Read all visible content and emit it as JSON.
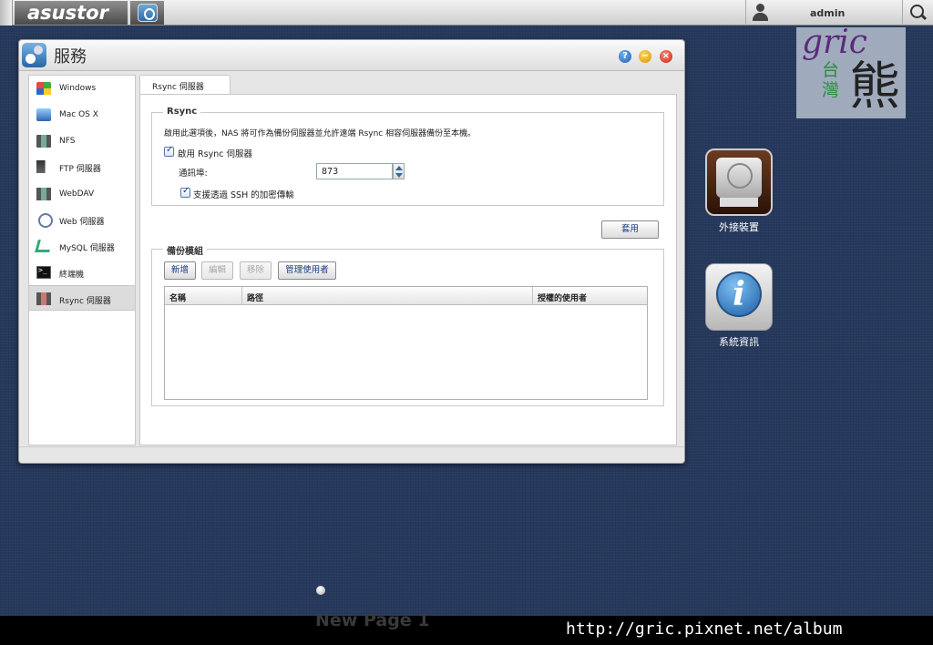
{
  "topbar": {
    "logo": "asustor",
    "user_name": "admin"
  },
  "watermark": {
    "text": "gric",
    "country": "台灣",
    "bear": "熊"
  },
  "desktop": {
    "icons": [
      {
        "label": "外接裝置",
        "icon": "external-drive-icon"
      },
      {
        "label": "系統資訊",
        "icon": "info-icon"
      }
    ]
  },
  "window": {
    "title": "服務",
    "buttons": {
      "help": "?",
      "minimize": "−",
      "close": "×"
    },
    "sidebar": {
      "items": [
        {
          "label": "Windows",
          "icon": "windows-icon"
        },
        {
          "label": "Mac OS X",
          "icon": "mac-icon"
        },
        {
          "label": "NFS",
          "icon": "nfs-icon"
        },
        {
          "label": "FTP 伺服器",
          "icon": "ftp-icon"
        },
        {
          "label": "WebDAV",
          "icon": "webdav-icon"
        },
        {
          "label": "Web 伺服器",
          "icon": "web-icon"
        },
        {
          "label": "MySQL 伺服器",
          "icon": "mysql-icon"
        },
        {
          "label": "終端機",
          "icon": "terminal-icon"
        },
        {
          "label": "Rsync 伺服器",
          "icon": "rsync-icon",
          "active": true
        }
      ]
    },
    "tab": "Rsync 伺服器",
    "rsync": {
      "legend": "Rsync",
      "description": "啟用此選項後，NAS 將可作為備份伺服器並允許遠端 Rsync 相容伺服器備份至本機。",
      "enable_label": "啟用 Rsync 伺服器",
      "enable_checked": true,
      "port_label": "通訊埠:",
      "port_value": "873",
      "ssh_label": "支援透過 SSH 的加密傳輸",
      "ssh_checked": true
    },
    "apply_label": "套用",
    "backup": {
      "legend": "備份模組",
      "buttons": {
        "add": "新增",
        "edit": "編輯",
        "remove": "移除",
        "manage_users": "管理使用者"
      },
      "columns": [
        "名稱",
        "路徑",
        "授權的使用者"
      ],
      "rows": []
    }
  },
  "footer": {
    "page_label": "New Page 1",
    "url": "http://gric.pixnet.net/album"
  }
}
